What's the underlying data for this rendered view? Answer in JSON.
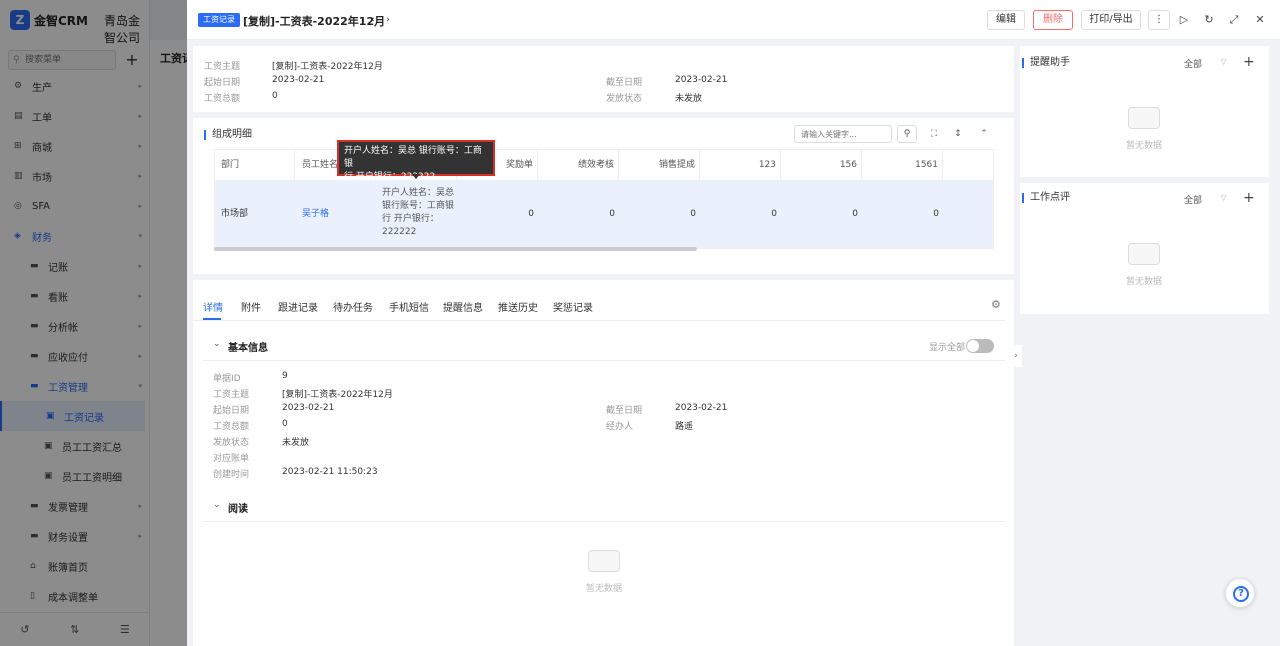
{
  "sidebar": {
    "logo_text": "Z",
    "app_name": "金智CRM",
    "company": "青岛金智公司",
    "search_placeholder": "搜索菜单",
    "add_icon": "plus-icon",
    "items": [
      {
        "label": "生产",
        "icon": "factory-icon"
      },
      {
        "label": "工单",
        "icon": "ticket-icon"
      },
      {
        "label": "商城",
        "icon": "store-icon"
      },
      {
        "label": "市场",
        "icon": "market-icon"
      },
      {
        "label": "SFA",
        "icon": "sfa-icon"
      },
      {
        "label": "财务",
        "icon": "finance-icon"
      },
      {
        "label": "记账",
        "icon": "folder-icon"
      },
      {
        "label": "看账",
        "icon": "folder-icon"
      },
      {
        "label": "分析帐",
        "icon": "folder-icon"
      },
      {
        "label": "应收应付",
        "icon": "folder-icon"
      },
      {
        "label": "工资管理",
        "icon": "folder-icon"
      },
      {
        "label": "工资记录",
        "icon": "doc-icon"
      },
      {
        "label": "员工工资汇总",
        "icon": "doc-icon"
      },
      {
        "label": "员工工资明细",
        "icon": "doc-icon"
      },
      {
        "label": "发票管理",
        "icon": "folder-icon"
      },
      {
        "label": "财务设置",
        "icon": "folder-icon"
      },
      {
        "label": "账簿首页",
        "icon": "home-icon"
      },
      {
        "label": "成本调整单",
        "icon": "doc-icon"
      }
    ]
  },
  "bg_page": {
    "title": "工资记"
  },
  "drawer": {
    "tag": "工资记录",
    "title": "[复制]-工资表-2022年12月",
    "buttons": {
      "edit": "编辑",
      "delete": "删除",
      "print": "打印/导出",
      "more": "⋮"
    }
  },
  "summary": {
    "fields": [
      {
        "label": "工资主题",
        "value": "[复制]-工资表-2022年12月"
      },
      {
        "label": "起始日期",
        "value": "2023-02-21"
      },
      {
        "label": "截至日期",
        "value": "2023-02-21"
      },
      {
        "label": "工资总额",
        "value": "0"
      },
      {
        "label": "发放状态",
        "value": "未发放"
      }
    ]
  },
  "composition": {
    "title": "组成明细",
    "search_placeholder": "请输入关键字...",
    "columns": [
      "部门",
      "员工姓名",
      "",
      "奖励单",
      "绩效考核",
      "销售提成",
      "123",
      "156",
      "1561"
    ],
    "row": {
      "dept": "市场部",
      "name": "吴子格",
      "bank": "开户人姓名：吴总 银行账号：工商银行 开户银行：222222",
      "bank_lines": [
        "开户人姓名：吴总",
        "银行账号：工商银",
        "行 开户银行：",
        "222222"
      ],
      "values": [
        "0",
        "0",
        "0",
        "0",
        "0",
        "0"
      ]
    },
    "tooltip_lines": [
      "开户人姓名：吴总 银行账号：工商银",
      "行 开户银行：222222"
    ]
  },
  "tabs": [
    "详情",
    "附件",
    "跟进记录",
    "待办任务",
    "手机短信",
    "提醒信息",
    "推送历史",
    "奖惩记录"
  ],
  "basic_info": {
    "title": "基本信息",
    "show_all": "显示全部",
    "fields": [
      {
        "label": "单据ID",
        "value": "9"
      },
      {
        "label": "工资主题",
        "value": "[复制]-工资表-2022年12月"
      },
      {
        "label": "起始日期",
        "value": "2023-02-21"
      },
      {
        "label": "截至日期",
        "value": "2023-02-21"
      },
      {
        "label": "工资总额",
        "value": "0"
      },
      {
        "label": "经办人",
        "value": "路遥"
      },
      {
        "label": "发放状态",
        "value": "未发放"
      },
      {
        "label": "对应账单",
        "value": ""
      },
      {
        "label": "创建时间",
        "value": "2023-02-21 11:50:23"
      }
    ]
  },
  "read_section": {
    "title": "阅读",
    "empty": "暂无数据"
  },
  "right": {
    "reminder": {
      "title": "提醒助手",
      "filter": "全部",
      "empty": "暂无数据"
    },
    "review": {
      "title": "工作点评",
      "filter": "全部",
      "empty": "暂无数据"
    }
  }
}
